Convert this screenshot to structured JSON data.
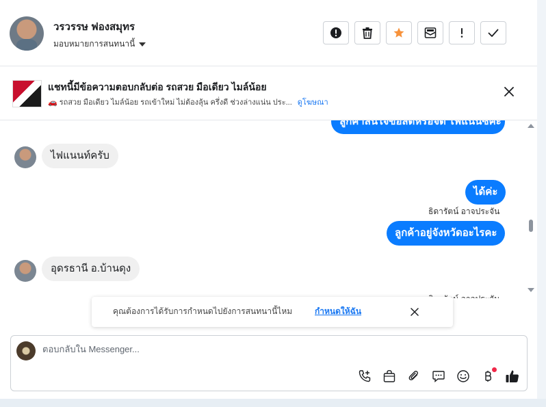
{
  "header": {
    "contact_name": "วรวรรษ ฟองสมุทร",
    "assign_label": "มอบหมายการสนทนานี้",
    "actions": [
      {
        "name": "spam-button",
        "icon": "exclamation-circle-icon"
      },
      {
        "name": "delete-button",
        "icon": "trash-icon"
      },
      {
        "name": "star-button",
        "icon": "star-icon"
      },
      {
        "name": "mark-unread-button",
        "icon": "envelope-icon"
      },
      {
        "name": "follow-up-button",
        "icon": "exclamation-icon"
      },
      {
        "name": "mark-done-button",
        "icon": "check-icon"
      }
    ]
  },
  "ad": {
    "title": "แชทนี้มีข้อความตอบกลับต่อ รถสวย มือเดียว ไมล์น้อย",
    "description": "🚗 รถสวย มือเดียว ไมล์น้อย รถเข้าใหม่ ไม่ต้องลุ้น ครึ่งดี ช่วงล่างแน่น ประ...",
    "link_label": "ดูโฆษณา"
  },
  "messages": {
    "top_cut_bubble": "ลูกค้าสนใจข้อสดหรือจัด ไฟแนนซ์คะ",
    "incoming_1": "ไฟแนนท์ครับ",
    "outgoing_1": "ได้ค่ะ",
    "sender_name": "ธิดารัตน์ อาจประจัน",
    "outgoing_2": "ลูกค้าอยู่จังหวัดอะไรคะ",
    "incoming_2": "อุดรธานี  อ.บ้านดุง",
    "sender_name_cut": "ธิดารัตน์ อาจประจัน"
  },
  "reminder": {
    "text": "คุณต้องการได้รับการกำหนดไปยังการสนทนานี้ไหม",
    "link_label": "กำหนดให้ฉัน"
  },
  "composer": {
    "placeholder": "ตอบกลับใน Messenger...",
    "tools": [
      "phone-plus-icon",
      "bag-icon",
      "paperclip-icon",
      "chat-bubble-icon",
      "emoji-icon",
      "baht-icon",
      "thumbs-up-icon"
    ]
  },
  "colors": {
    "accent": "#0a7cff",
    "star": "#f7923b",
    "badge": "#f02849"
  }
}
